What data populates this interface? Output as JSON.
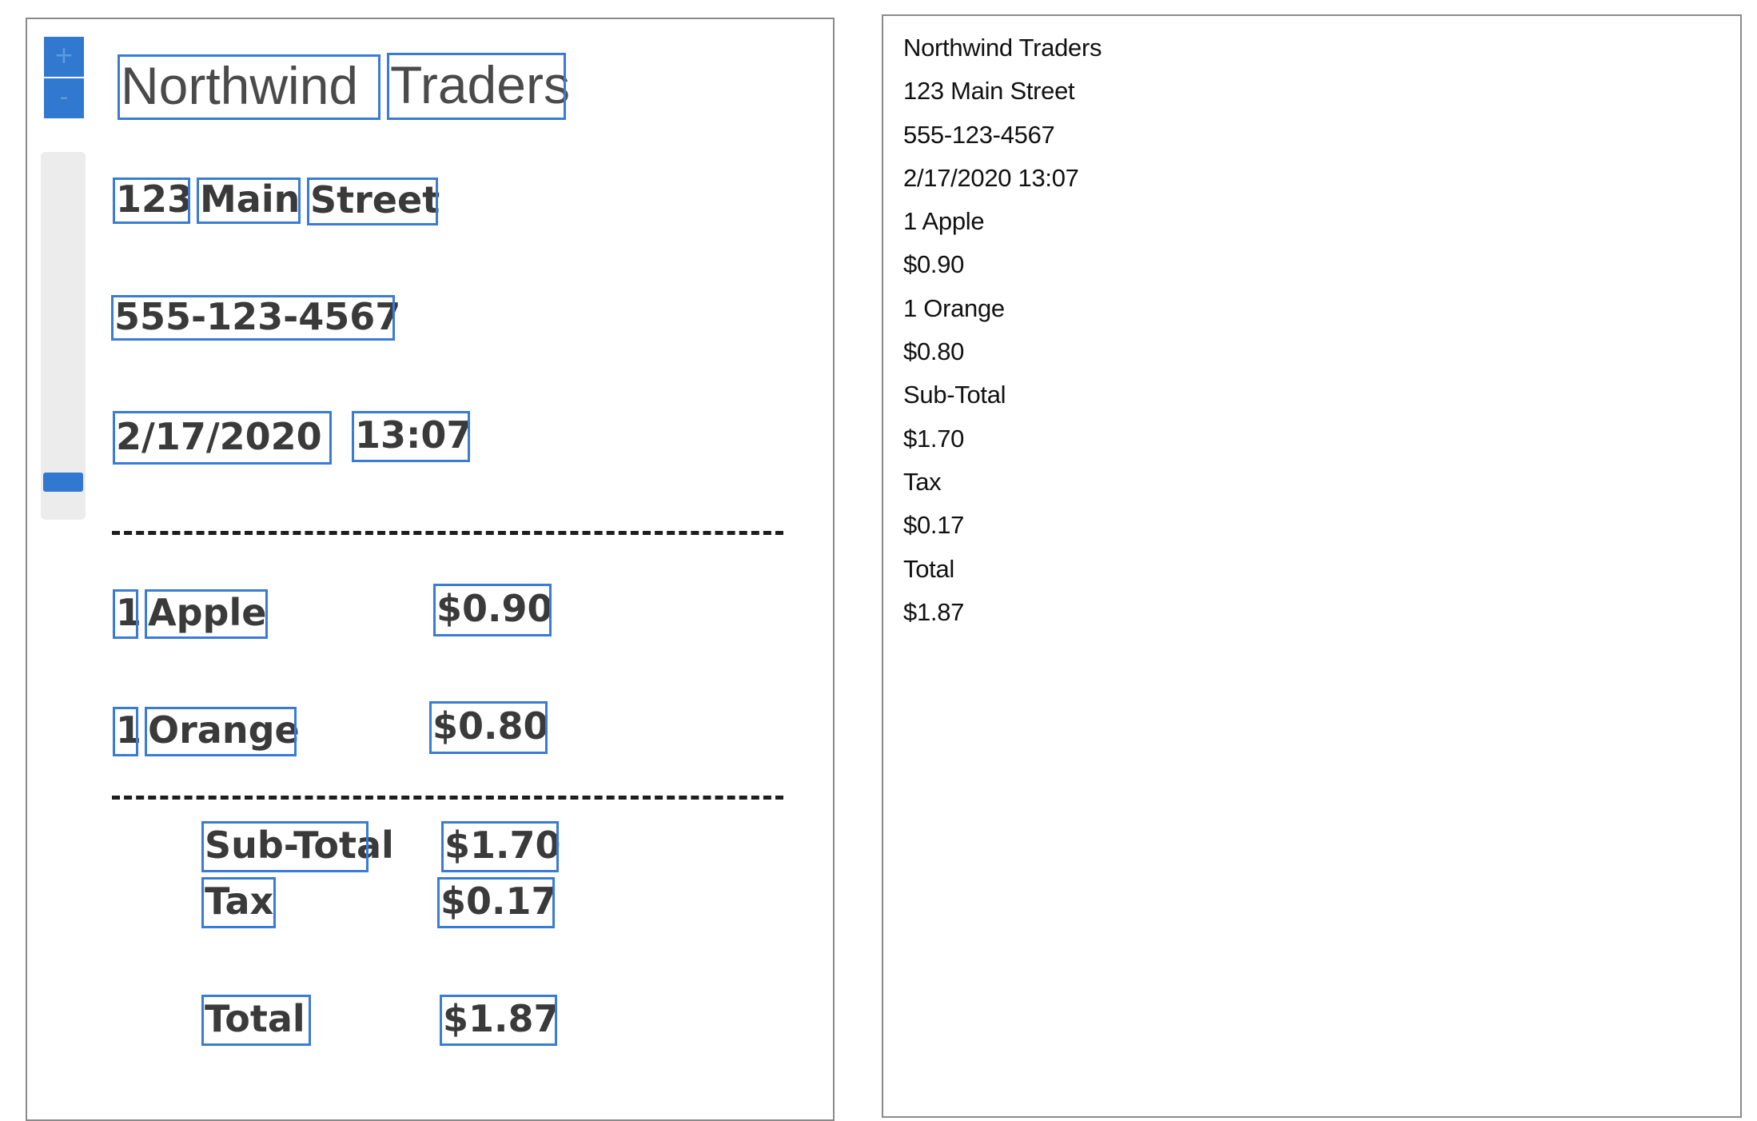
{
  "viewer": {
    "zoom_in_label": "+",
    "zoom_out_label": "-",
    "zoom_level": 0.06,
    "receipt_words": [
      {
        "text": "Northwind",
        "line": "store_name"
      },
      {
        "text": "Traders",
        "line": "store_name"
      },
      {
        "text": "123",
        "line": "address"
      },
      {
        "text": "Main",
        "line": "address"
      },
      {
        "text": "Street",
        "line": "address"
      },
      {
        "text": "555-123-4567",
        "line": "phone"
      },
      {
        "text": "2/17/2020",
        "line": "datetime"
      },
      {
        "text": "13:07",
        "line": "datetime"
      },
      {
        "text": "1",
        "line": "item_1"
      },
      {
        "text": "Apple",
        "line": "item_1"
      },
      {
        "text": "$0.90",
        "line": "item_1"
      },
      {
        "text": "1",
        "line": "item_2"
      },
      {
        "text": "Orange",
        "line": "item_2"
      },
      {
        "text": "$0.80",
        "line": "item_2"
      },
      {
        "text": "Sub-Total",
        "line": "subtotal"
      },
      {
        "text": "$1.70",
        "line": "subtotal"
      },
      {
        "text": "Tax",
        "line": "tax"
      },
      {
        "text": "$0.17",
        "line": "tax"
      },
      {
        "text": "Total",
        "line": "total"
      },
      {
        "text": "$1.87",
        "line": "total"
      }
    ]
  },
  "extracted_text": {
    "lines": [
      "Northwind Traders",
      "123 Main Street",
      "555-123-4567",
      "2/17/2020 13:07",
      "1 Apple",
      "$0.90",
      "1 Orange",
      "$0.80",
      "Sub-Total",
      "$1.70",
      "Tax",
      "$0.17",
      "Total",
      "$1.87"
    ]
  },
  "colors": {
    "accent": "#3178d0",
    "box_outline": "#3a7bd5",
    "panel_border": "#8a8a8a",
    "receipt_text": "#3a3a3a"
  }
}
